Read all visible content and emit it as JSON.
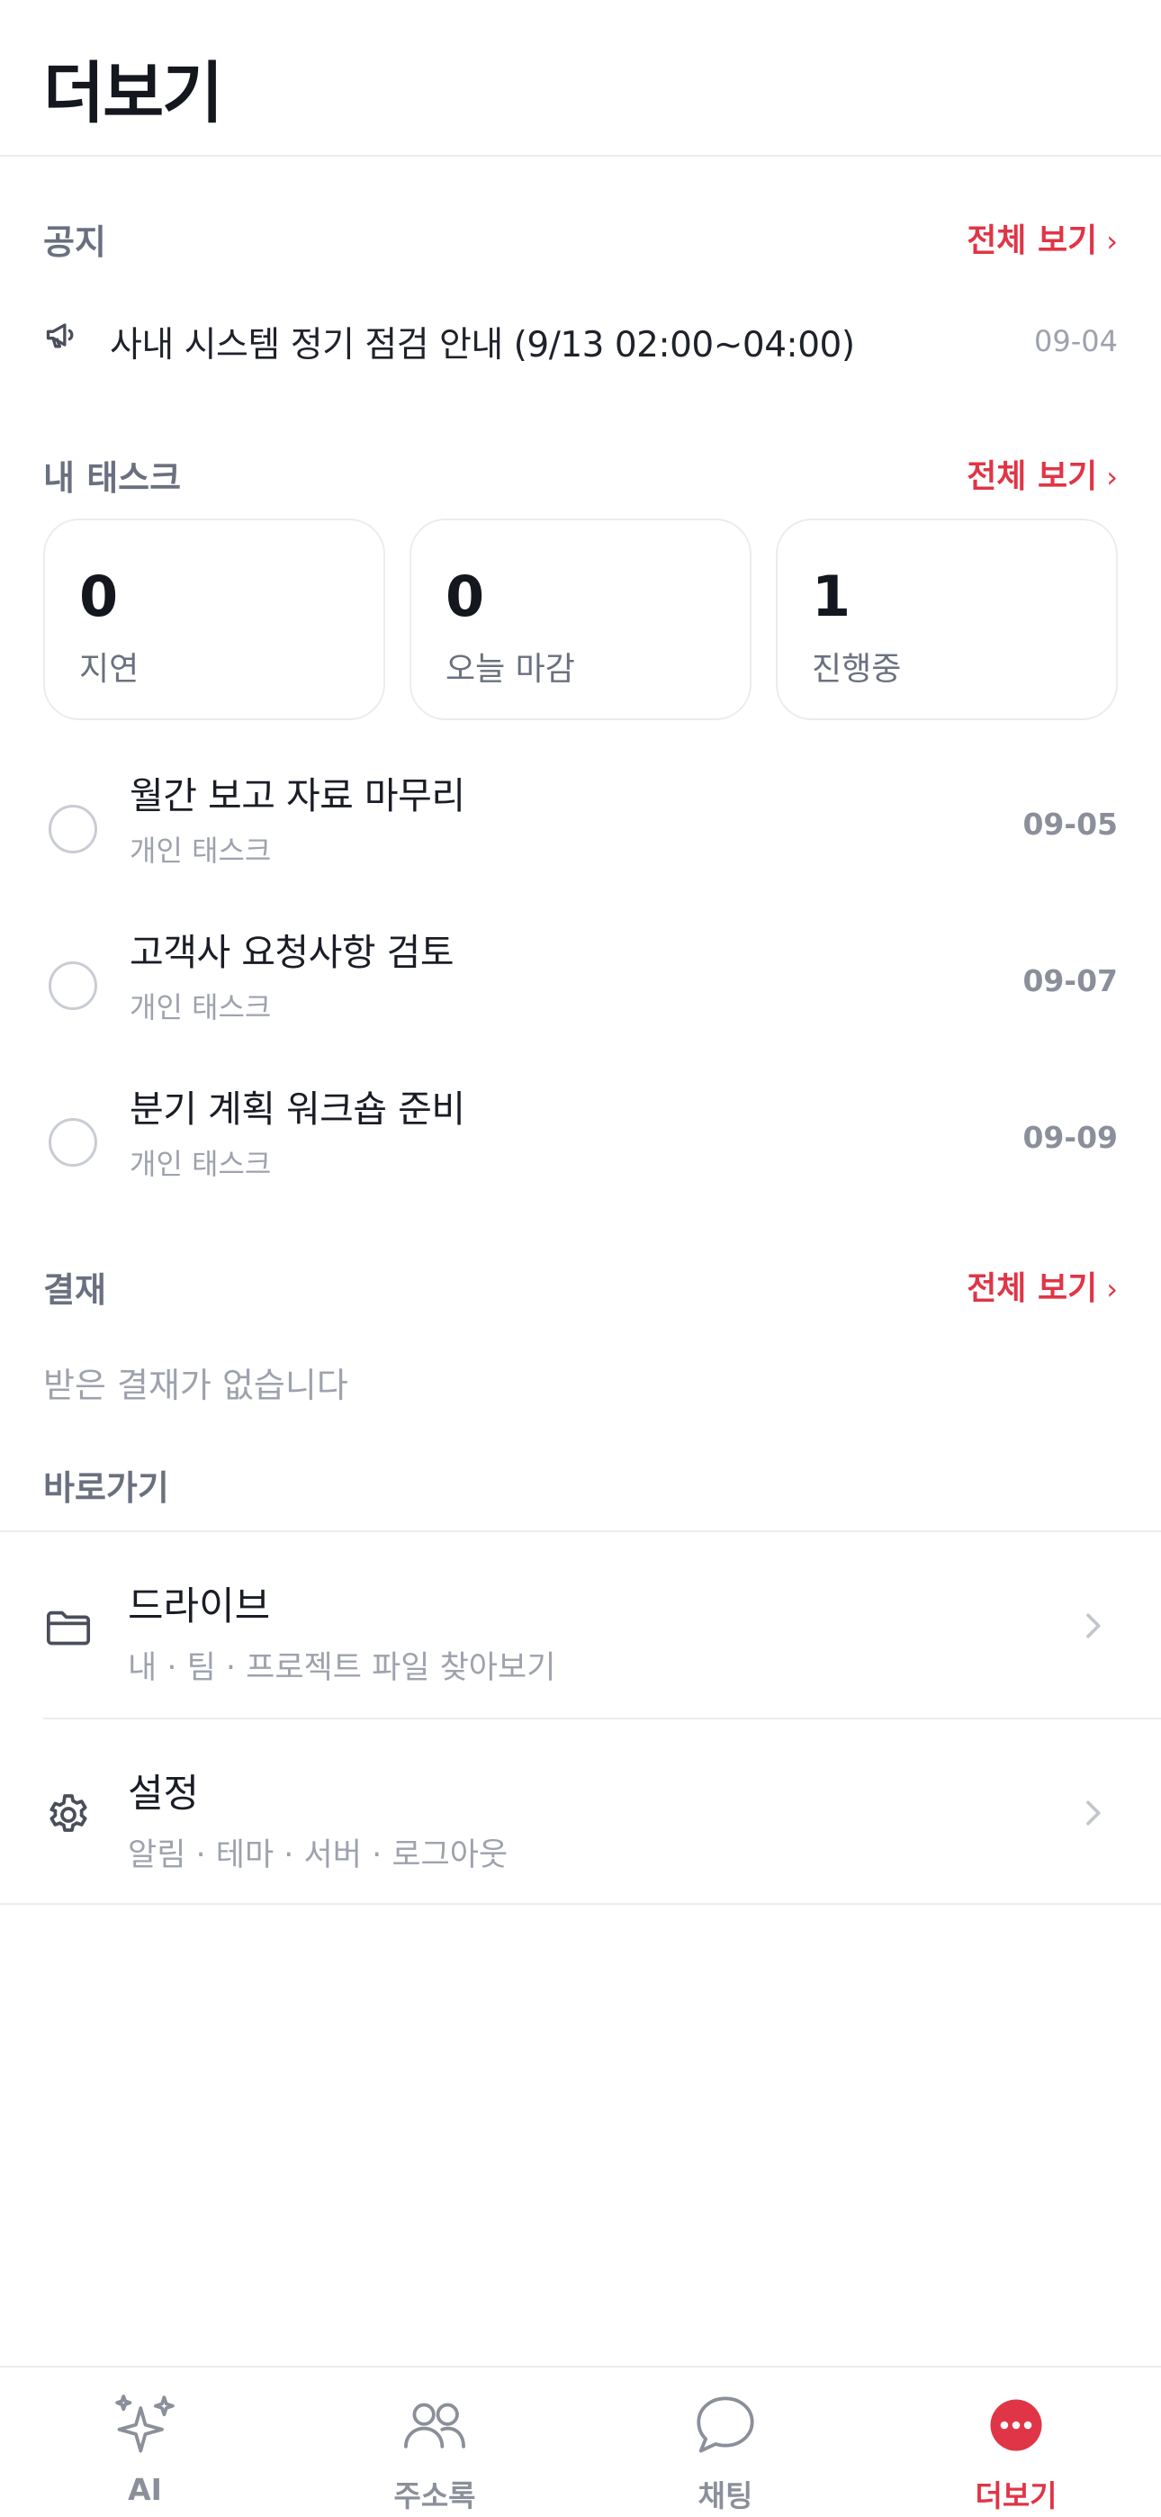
{
  "header": {
    "title": "더보기"
  },
  "notice": {
    "section_title": "공지",
    "see_all_label": "전체 보기",
    "see_all_chevron": "›",
    "item": {
      "title": "사내 시스템 정기 점검 안내 (9/13 02:00~04:00)",
      "date": "09-04",
      "icon": "megaphone-icon"
    }
  },
  "tasks": {
    "section_title": "내 태스크",
    "see_all_label": "전체 보기",
    "see_all_chevron": "›",
    "stats": [
      {
        "value": "0",
        "label": "지연"
      },
      {
        "value": "0",
        "label": "오늘 마감"
      },
      {
        "value": "1",
        "label": "진행중"
      }
    ],
    "items": [
      {
        "title": "월간 보고 자료 마무리",
        "subtitle": "개인 태스크",
        "date": "09-05"
      },
      {
        "title": "고객사 요청사항 검토",
        "subtitle": "개인 태스크",
        "date": "09-07"
      },
      {
        "title": "분기 계획 워크숍 준비",
        "subtitle": "개인 태스크",
        "date": "09-09"
      }
    ]
  },
  "approval": {
    "section_title": "결재",
    "see_all_label": "전체 보기",
    "see_all_chevron": "›",
    "empty_text": "받은 결재가 없습니다"
  },
  "shortcuts": {
    "section_title": "바로가기",
    "items": [
      {
        "title": "드라이브",
        "subtitle": "내 · 팀 · 프로젝트 파일 찾아보기",
        "icon": "folder-icon"
      },
      {
        "title": "설정",
        "subtitle": "알림 · 테마 · 서버 · 로그아웃",
        "icon": "gear-icon"
      }
    ]
  },
  "bottom_nav": {
    "items": [
      {
        "label": "AI",
        "icon": "sparkles-icon",
        "active": false
      },
      {
        "label": "주소록",
        "icon": "contacts-icon",
        "active": false
      },
      {
        "label": "채팅",
        "icon": "chat-bubble-icon",
        "active": false
      },
      {
        "label": "더보기",
        "icon": "more-dots-icon",
        "active": true
      }
    ]
  },
  "colors": {
    "accent": "#e03546",
    "text_primary": "#1a1d26",
    "text_secondary": "#6b7080",
    "text_muted": "#9ea2ad",
    "border": "#ececf0"
  }
}
